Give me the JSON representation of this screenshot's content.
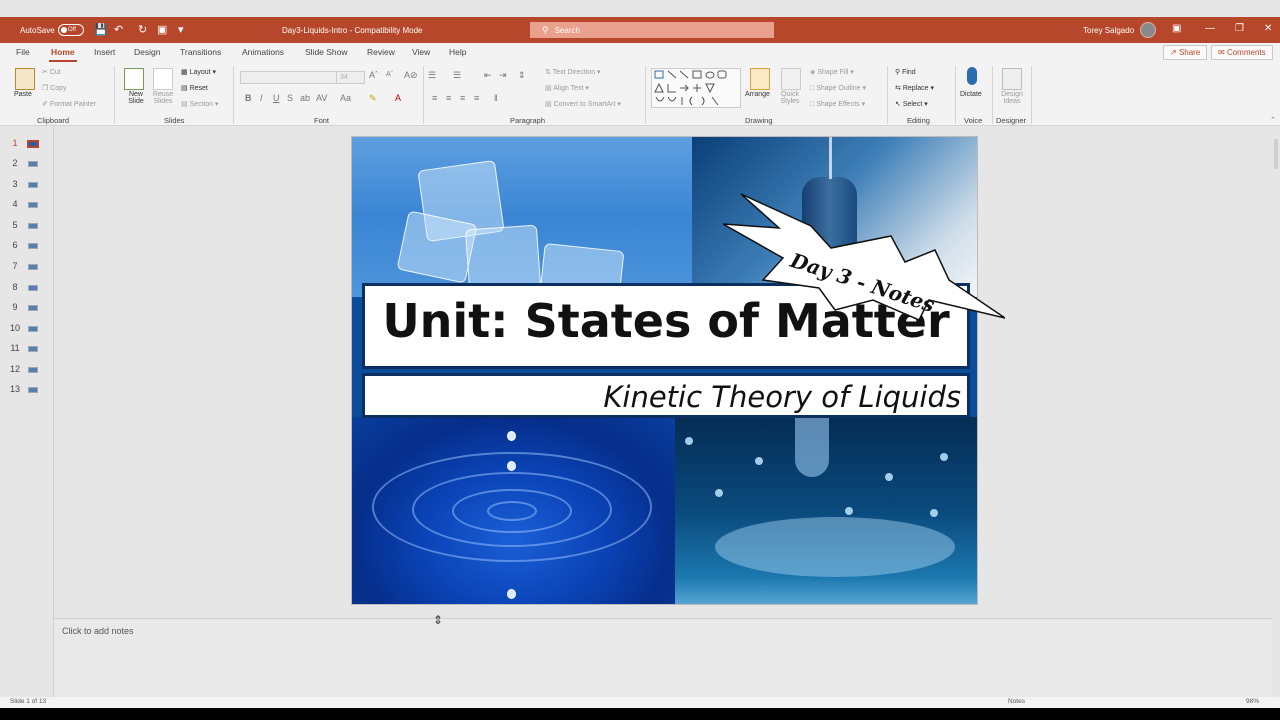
{
  "titlebar": {
    "autosave_label": "AutoSave",
    "autosave_state": "Off",
    "document_title": "Day3-Liquids-Intro  -  Compatibility Mode",
    "search_placeholder": "Search",
    "user_name": "Torey Salgado"
  },
  "menu": {
    "tabs": [
      "File",
      "Home",
      "Insert",
      "Design",
      "Transitions",
      "Animations",
      "Slide Show",
      "Review",
      "View",
      "Help"
    ],
    "active_tab": "Home",
    "share_label": "Share",
    "comments_label": "Comments"
  },
  "ribbon": {
    "clipboard": {
      "paste": "Paste",
      "cut": "Cut",
      "copy": "Copy",
      "format_painter": "Format Painter",
      "label": "Clipboard"
    },
    "slides": {
      "new_slide": "New Slide",
      "reuse_slides": "Reuse Slides",
      "layout": "Layout",
      "reset": "Reset",
      "section": "Section",
      "label": "Slides"
    },
    "font": {
      "label": "Font",
      "size": "34"
    },
    "paragraph": {
      "text_direction": "Text Direction",
      "align_text": "Align Text",
      "convert_smartart": "Convert to SmartArt",
      "label": "Paragraph"
    },
    "drawing": {
      "arrange": "Arrange",
      "quick_styles": "Quick Styles",
      "shape_fill": "Shape Fill",
      "shape_outline": "Shape Outline",
      "shape_effects": "Shape Effects",
      "label": "Drawing"
    },
    "editing": {
      "find": "Find",
      "replace": "Replace",
      "select": "Select",
      "label": "Editing"
    },
    "voice": {
      "dictate": "Dictate",
      "label": "Voice"
    },
    "designer": {
      "design_ideas": "Design Ideas",
      "label": "Designer"
    }
  },
  "slides_panel": {
    "numbers": [
      "1",
      "2",
      "3",
      "4",
      "5",
      "6",
      "7",
      "8",
      "9",
      "10",
      "11",
      "12",
      "13"
    ],
    "active": 1
  },
  "slide": {
    "title": "Unit: States of Matter",
    "subtitle": "Kinetic Theory of Liquids",
    "burst_text": "Day 3 - Notes"
  },
  "notes": {
    "placeholder": "Click to add notes"
  },
  "statusbar": {
    "slide_info": "Slide 1 of 13",
    "notes_label": "Notes",
    "zoom": "98%"
  },
  "colors": {
    "accent": "#b7472a",
    "title_border": "#0c2f62"
  }
}
